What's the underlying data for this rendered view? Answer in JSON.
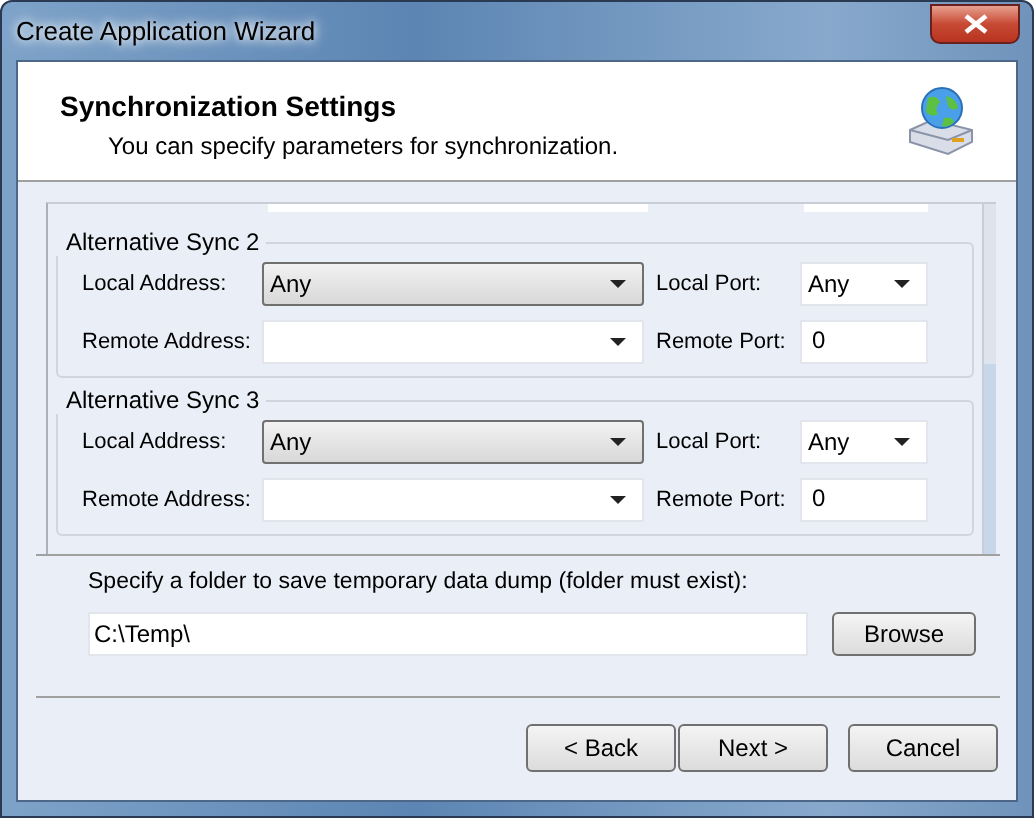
{
  "window": {
    "title": "Create Application Wizard"
  },
  "header": {
    "title": "Synchronization Settings",
    "subtitle": "You can specify parameters for synchronization."
  },
  "groups": [
    {
      "title": "Alternative Sync 2",
      "local_address": {
        "label": "Local Address:",
        "value": "Any"
      },
      "local_port": {
        "label": "Local Port:",
        "value": "Any"
      },
      "remote_address": {
        "label": "Remote Address:"
      },
      "remote_port": {
        "label": "Remote Port:",
        "value": "0"
      }
    },
    {
      "title": "Alternative Sync 3",
      "local_address": {
        "label": "Local Address:",
        "value": "Any"
      },
      "local_port": {
        "label": "Local Port:",
        "value": "Any"
      },
      "remote_address": {
        "label": "Remote Address:"
      },
      "remote_port": {
        "label": "Remote Port:",
        "value": "0"
      }
    }
  ],
  "folder": {
    "label": "Specify a folder to save temporary data dump (folder must exist):",
    "value": "C:\\Temp\\",
    "browse": "Browse"
  },
  "buttons": [
    {
      "label": "< Back"
    },
    {
      "label": "Next >"
    },
    {
      "label": "Cancel"
    }
  ]
}
